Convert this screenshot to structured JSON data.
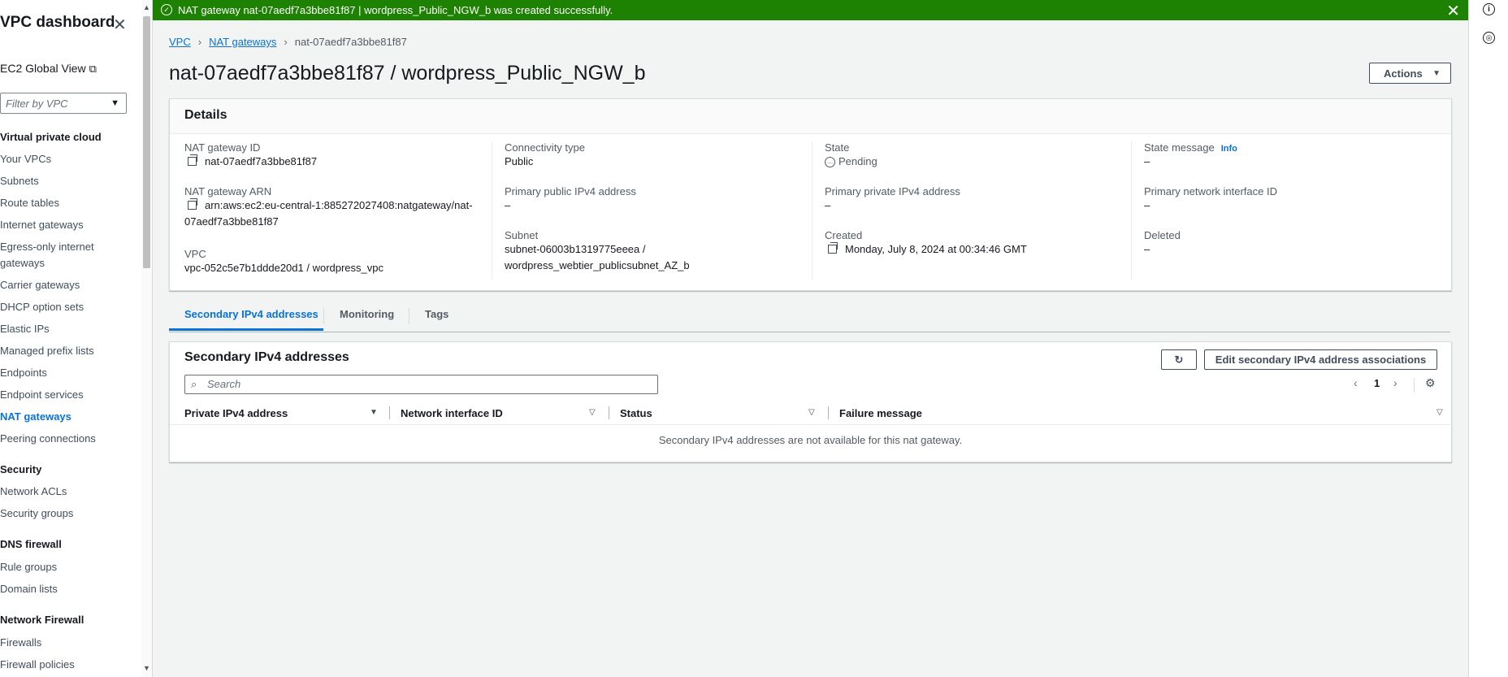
{
  "sidebar": {
    "title": "VPC dashboard",
    "ec2_global_view": "EC2 Global View",
    "filter_placeholder": "Filter by VPC",
    "sections": [
      {
        "heading": "Virtual private cloud",
        "items": [
          "Your VPCs",
          "Subnets",
          "Route tables",
          "Internet gateways",
          "Egress-only internet gateways",
          "Carrier gateways",
          "DHCP option sets",
          "Elastic IPs",
          "Managed prefix lists",
          "Endpoints",
          "Endpoint services",
          "NAT gateways",
          "Peering connections"
        ]
      },
      {
        "heading": "Security",
        "items": [
          "Network ACLs",
          "Security groups"
        ]
      },
      {
        "heading": "DNS firewall",
        "items": [
          "Rule groups",
          "Domain lists"
        ]
      },
      {
        "heading": "Network Firewall",
        "items": [
          "Firewalls",
          "Firewall policies"
        ]
      }
    ],
    "active_item": "NAT gateways"
  },
  "flash": {
    "message": "NAT gateway nat-07aedf7a3bbe81f87 | wordpress_Public_NGW_b was created successfully."
  },
  "breadcrumb": {
    "vpc": "VPC",
    "nat_gateways": "NAT gateways",
    "current": "nat-07aedf7a3bbe81f87"
  },
  "page_title": "nat-07aedf7a3bbe81f87 / wordpress_Public_NGW_b",
  "actions_label": "Actions",
  "details": {
    "heading": "Details",
    "nat_gateway_id_label": "NAT gateway ID",
    "nat_gateway_id": "nat-07aedf7a3bbe81f87",
    "nat_gateway_arn_label": "NAT gateway ARN",
    "nat_gateway_arn_line1": "arn:aws:ec2:eu-central-1:885272027408:natgateway/nat-",
    "nat_gateway_arn_line2": "07aedf7a3bbe81f87",
    "vpc_label": "VPC",
    "vpc": "vpc-052c5e7b1ddde20d1 / wordpress_vpc",
    "connectivity_type_label": "Connectivity type",
    "connectivity_type": "Public",
    "primary_public_ipv4_label": "Primary public IPv4 address",
    "primary_public_ipv4": "–",
    "subnet_label": "Subnet",
    "subnet_line1": "subnet-06003b1319775eeea /",
    "subnet_line2": "wordpress_webtier_publicsubnet_AZ_b",
    "state_label": "State",
    "state": "Pending",
    "primary_private_ipv4_label": "Primary private IPv4 address",
    "primary_private_ipv4": "–",
    "created_label": "Created",
    "created": "Monday, July 8, 2024 at 00:34:46 GMT",
    "state_message_label": "State message",
    "info_label": "Info",
    "state_message": "–",
    "primary_network_interface_label": "Primary network interface ID",
    "primary_network_interface": "–",
    "deleted_label": "Deleted",
    "deleted": "–"
  },
  "tabs": [
    "Secondary IPv4 addresses",
    "Monitoring",
    "Tags"
  ],
  "secondary": {
    "title": "Secondary IPv4 addresses",
    "edit_button": "Edit secondary IPv4 address associations",
    "search_placeholder": "Search",
    "page_number": "1",
    "columns": [
      "Private IPv4 address",
      "Network interface ID",
      "Status",
      "Failure message"
    ],
    "empty_message": "Secondary IPv4 addresses are not available for this nat gateway."
  }
}
